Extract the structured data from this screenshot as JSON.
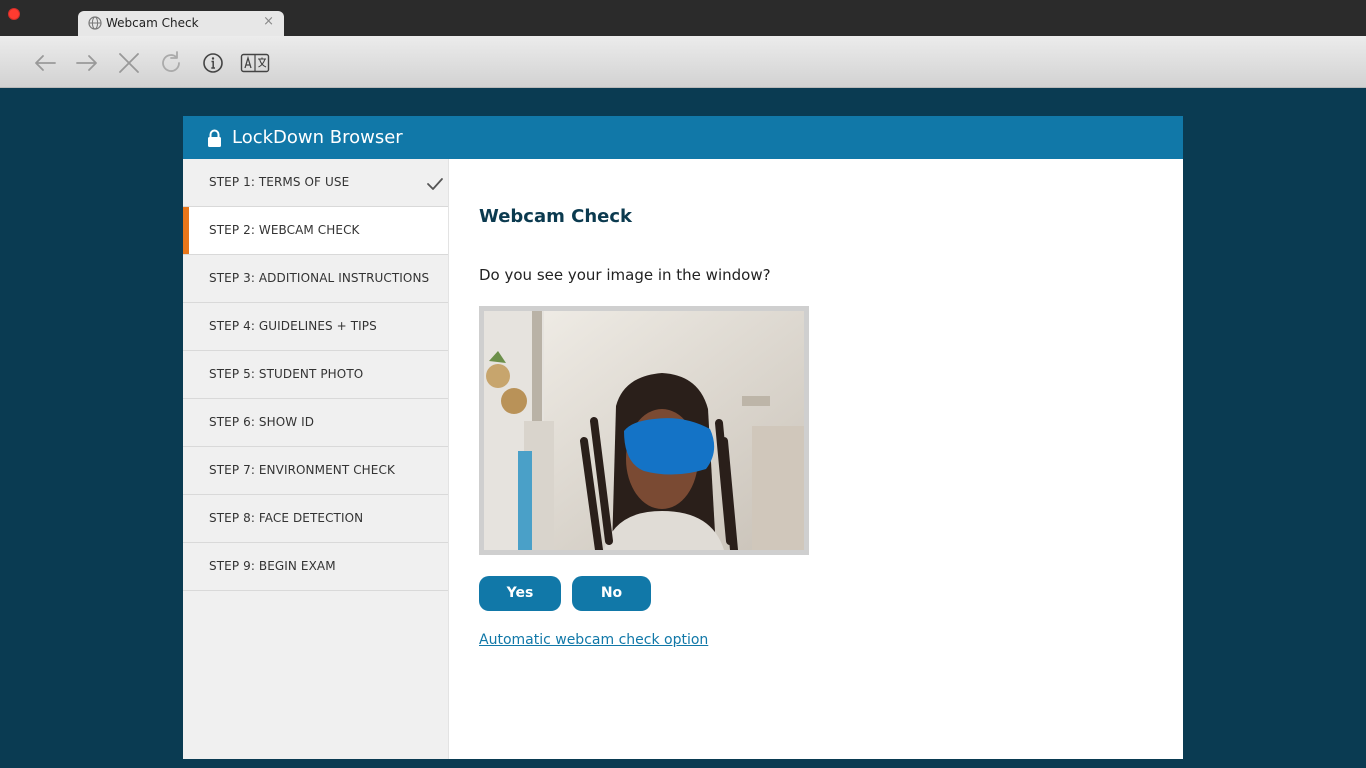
{
  "browser": {
    "tab_title": "Webcam Check",
    "tab_close": "×"
  },
  "app": {
    "title": "LockDown Browser",
    "header_color": "#1178a8",
    "accent_color": "#e8761a"
  },
  "steps": [
    {
      "label": "STEP 1: TERMS OF USE",
      "completed": true
    },
    {
      "label": "STEP 2: WEBCAM CHECK",
      "active": true
    },
    {
      "label": "STEP 3: ADDITIONAL INSTRUCTIONS"
    },
    {
      "label": "STEP 4: GUIDELINES + TIPS"
    },
    {
      "label": "STEP 5: STUDENT PHOTO"
    },
    {
      "label": "STEP 6: SHOW ID"
    },
    {
      "label": "STEP 7: ENVIRONMENT CHECK"
    },
    {
      "label": "STEP 8: FACE DETECTION"
    },
    {
      "label": "STEP 9: BEGIN EXAM"
    }
  ],
  "main": {
    "heading": "Webcam Check",
    "question": "Do you see your image in the window?",
    "yes_label": "Yes",
    "no_label": "No",
    "auto_link": "Automatic webcam check option"
  },
  "icons": {
    "back": "back-arrow-icon",
    "forward": "forward-arrow-icon",
    "stop": "stop-icon",
    "reload": "reload-icon",
    "info": "info-icon",
    "translate": "translate-icon",
    "lock": "lock-icon",
    "check": "checkmark-icon"
  }
}
